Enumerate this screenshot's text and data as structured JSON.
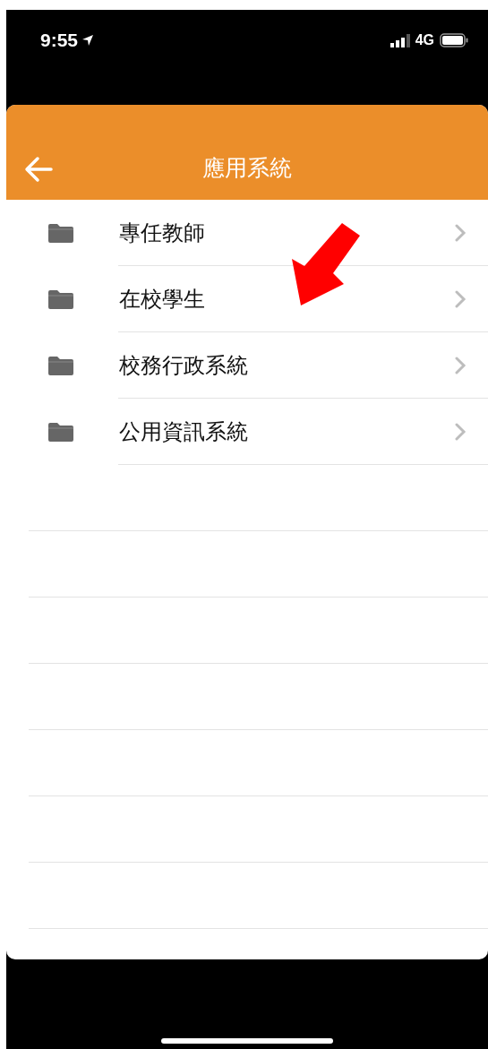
{
  "status_bar": {
    "time": "9:55",
    "network": "4G"
  },
  "header": {
    "title": "應用系統"
  },
  "items": [
    {
      "label": "專任教師"
    },
    {
      "label": "在校學生"
    },
    {
      "label": "校務行政系統"
    },
    {
      "label": "公用資訊系統"
    }
  ]
}
